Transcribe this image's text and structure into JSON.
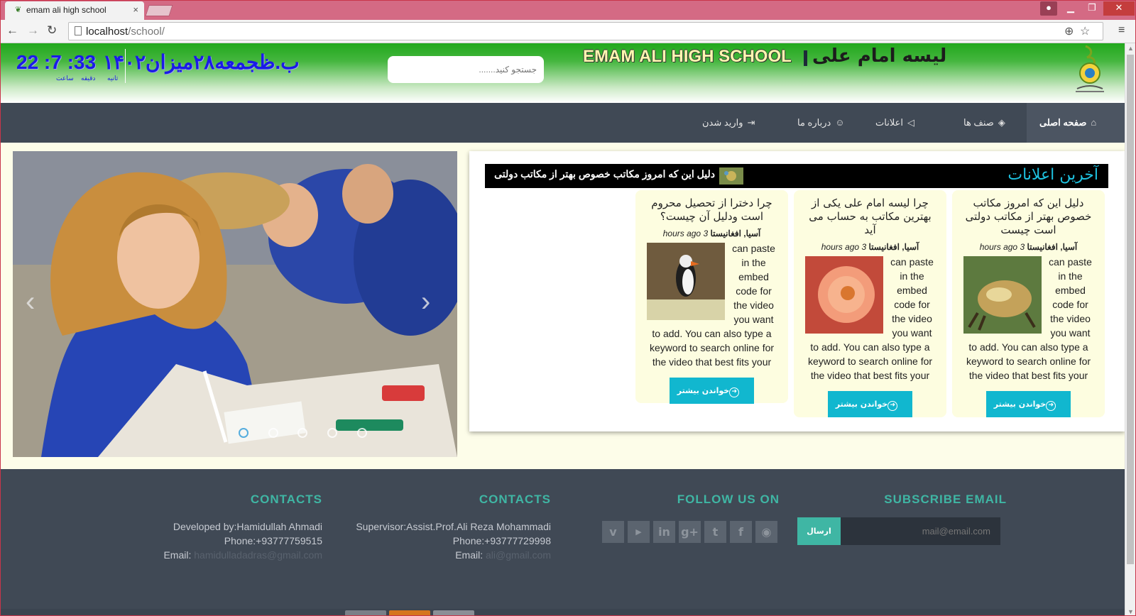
{
  "browser": {
    "tab_title": "emam ali high school",
    "tab_close": "×",
    "url_host": "localhost",
    "url_path": "/school/"
  },
  "header": {
    "clock": "22 :7 :33 ب.ظ",
    "date": "جمعه۲۸میزان۱۴۰۲",
    "clock_labels": [
      "ساعت",
      "دقیقه",
      "ثانیه"
    ],
    "search_placeholder": "جستجو کنید.......",
    "site_title": "EMAM ALI HIGH SCHOOL",
    "site_title_fa": "لیسه امام علی"
  },
  "nav": {
    "items": [
      {
        "label": "صفحه اصلی",
        "icon": "home-icon"
      },
      {
        "label": "صنف ها",
        "icon": "layers-icon"
      },
      {
        "label": "اعلانات",
        "icon": "megaphone-icon"
      },
      {
        "label": "درباره ما",
        "icon": "user-icon"
      },
      {
        "label": "وارید شدن",
        "icon": "sign-in-icon"
      }
    ]
  },
  "slider": {
    "prev": "‹",
    "next": "›",
    "slides": 5,
    "active_slide": 1
  },
  "news": {
    "heading": "آخرین اعلانات",
    "ticker": "دلیل این که امروز مکاتب خصوص بهتر از مکاتب دولتی",
    "cards": [
      {
        "title": "دلیل این که امروز مکاتب خصوص بهتر از مکاتب دولتی است چیست",
        "meta_time": "hours ago 3",
        "meta_place": "آسیا, افغانیستا",
        "body": "can paste in the embed code for the video you want to add. You can also type a keyword to search online for the video that best fits your",
        "image": "crab-photo",
        "button": "خواندن بیشتر"
      },
      {
        "title": "چرا لیسه امام علی یکی از بهترین مکاتب به حساب می آید",
        "meta_time": "hours ago 3",
        "meta_place": "آسیا, افغانیستا",
        "body": "can paste in the embed code for the video you want to add. You can also type a keyword to search online for the video that best fits your",
        "image": "flower-photo",
        "button": "خواندن بیشتر"
      },
      {
        "title": "چرا دخترا از تحصیل محروم است ودلیل آن چیست؟",
        "meta_time": "hours ago 3",
        "meta_place": "آسیا, افغانیستا",
        "body": "can paste in the embed code for the video you want to add. You can also type a keyword to search online for the video that best fits your",
        "image": "puffin-photo",
        "button": "خواندن بیشتر"
      }
    ]
  },
  "footer": {
    "contacts1": {
      "heading": "CONTACTS",
      "line1": "Developed by:Hamidullah Ahmadi",
      "line2": "Phone:+93777759515",
      "email_label": "Email: ",
      "email": "hamidulladadras@gmail.com"
    },
    "contacts2": {
      "heading": "CONTACTS",
      "line1": "Supervisor:Assist.Prof.Ali Reza Mohammadi",
      "line2": "Phone:+93777729998",
      "email_label": "Email: ",
      "email": "ali@gmail.com"
    },
    "follow": {
      "heading": "FOLLOW US ON",
      "icons": [
        {
          "name": "vimeo-icon",
          "glyph": "v"
        },
        {
          "name": "youtube-icon",
          "glyph": "▶"
        },
        {
          "name": "linkedin-icon",
          "glyph": "in"
        },
        {
          "name": "google-plus-icon",
          "glyph": "g+"
        },
        {
          "name": "twitter-icon",
          "glyph": "t"
        },
        {
          "name": "facebook-icon",
          "glyph": "f"
        },
        {
          "name": "rss-icon",
          "glyph": "◉"
        }
      ]
    },
    "subscribe": {
      "heading": "SUBSCRIBE EMAIL",
      "button": "ارسال",
      "placeholder": "mail@email.com"
    }
  },
  "colors": {
    "nav_bg": "#404955",
    "accent_cyan": "#11b7cf",
    "footer_teal": "#3fb6a4",
    "header_green": "#21a81c",
    "clock_blue": "#1a1ae8"
  }
}
